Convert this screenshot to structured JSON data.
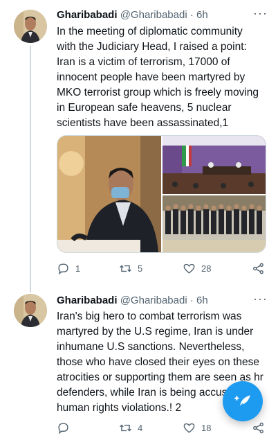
{
  "tweets": [
    {
      "display_name": "Gharibabadi",
      "handle": "@Gharibabadi",
      "dot": "·",
      "time": "6h",
      "more": "···",
      "text": "In the meeting of diplomatic community with the Judiciary Head, I raised a point: Iran is a victim of terrorism, 17000 of innocent people have been martyred by MKO terrorist group which is freely moving in European safe heavens, 5 nuclear scientists have been assassinated,1",
      "replies": "1",
      "retweets": "5",
      "likes": "28"
    },
    {
      "display_name": "Gharibabadi",
      "handle": "@Gharibabadi",
      "dot": "·",
      "time": "6h",
      "more": "···",
      "text": "Iran's big hero to combat terrorism was martyred by the U.S regime, Iran is under inhumane U.S sanctions. Nevertheless, those who have closed their eyes on these atrocities or supporting them are seen as hr defenders, while Iran is being accused of human rights violations.! 2",
      "replies": "",
      "retweets": "4",
      "likes": "18"
    }
  ],
  "colors": {
    "accent": "#1d9bf0",
    "meta": "#536471",
    "divider": "#cfd9de"
  },
  "icons": [
    "reply-icon",
    "retweet-icon",
    "like-icon",
    "share-icon",
    "compose-tweet-icon",
    "more-icon"
  ]
}
